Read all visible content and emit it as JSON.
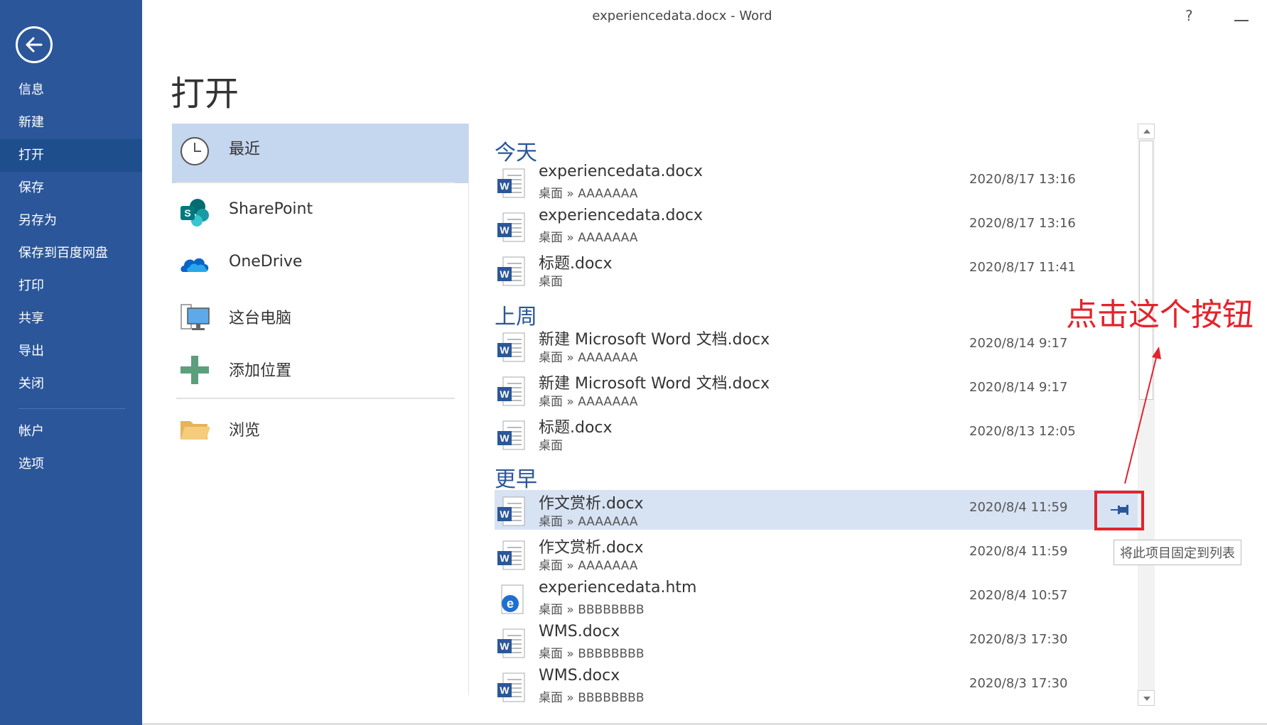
{
  "window": {
    "title": "experiencedata.docx - Word",
    "help": "?"
  },
  "nav": {
    "items": [
      {
        "label": "信息"
      },
      {
        "label": "新建"
      },
      {
        "label": "打开"
      },
      {
        "label": "保存"
      },
      {
        "label": "另存为"
      },
      {
        "label": "保存到百度网盘"
      },
      {
        "label": "打印"
      },
      {
        "label": "共享"
      },
      {
        "label": "导出"
      },
      {
        "label": "关闭"
      },
      {
        "label": "帐户"
      },
      {
        "label": "选项"
      }
    ],
    "active": "打开"
  },
  "page": {
    "title": "打开"
  },
  "places": {
    "recent": "最近",
    "sharepoint": "SharePoint",
    "onedrive": "OneDrive",
    "this_pc": "这台电脑",
    "add_place": "添加位置",
    "browse": "浏览"
  },
  "recent": {
    "groups": [
      {
        "heading": "今天",
        "files": [
          {
            "name": "experiencedata.docx",
            "path": "桌面 » AAAAAAA",
            "date": "2020/8/17 13:16",
            "type": "docx"
          },
          {
            "name": "experiencedata.docx",
            "path": "桌面 » AAAAAAA",
            "date": "2020/8/17 13:16",
            "type": "docx"
          },
          {
            "name": "标题.docx",
            "path": "桌面",
            "date": "2020/8/17 11:41",
            "type": "docx"
          }
        ]
      },
      {
        "heading": "上周",
        "files": [
          {
            "name": "新建 Microsoft Word 文档.docx",
            "path": "桌面 » AAAAAAA",
            "date": "2020/8/14 9:17",
            "type": "docx"
          },
          {
            "name": "新建 Microsoft Word 文档.docx",
            "path": "桌面 » AAAAAAA",
            "date": "2020/8/14 9:17",
            "type": "docx"
          },
          {
            "name": "标题.docx",
            "path": "桌面",
            "date": "2020/8/13 12:05",
            "type": "docx"
          }
        ]
      },
      {
        "heading": "更早",
        "files": [
          {
            "name": "作文赏析.docx",
            "path": "桌面 » AAAAAAA",
            "date": "2020/8/4 11:59",
            "type": "docx"
          },
          {
            "name": "作文赏析.docx",
            "path": "桌面 » AAAAAAA",
            "date": "2020/8/4 11:59",
            "type": "docx"
          },
          {
            "name": "experiencedata.htm",
            "path": "桌面 » BBBBBBBB",
            "date": "2020/8/4 10:57",
            "type": "htm"
          },
          {
            "name": "WMS.docx",
            "path": "桌面 » BBBBBBBB",
            "date": "2020/8/3 17:30",
            "type": "docx"
          },
          {
            "name": "WMS.docx",
            "path": "桌面 » BBBBBBBB",
            "date": "2020/8/3 17:30",
            "type": "docx"
          }
        ]
      }
    ]
  },
  "pin": {
    "tooltip": "将此项目固定到列表"
  },
  "annotation": {
    "text": "点击这个按钮",
    "color": "#e4232b"
  },
  "colors": {
    "nav_bg": "#2b579a",
    "accent": "#2b579a",
    "selected": "#c5d6ef",
    "hover": "#d7e2f3"
  }
}
